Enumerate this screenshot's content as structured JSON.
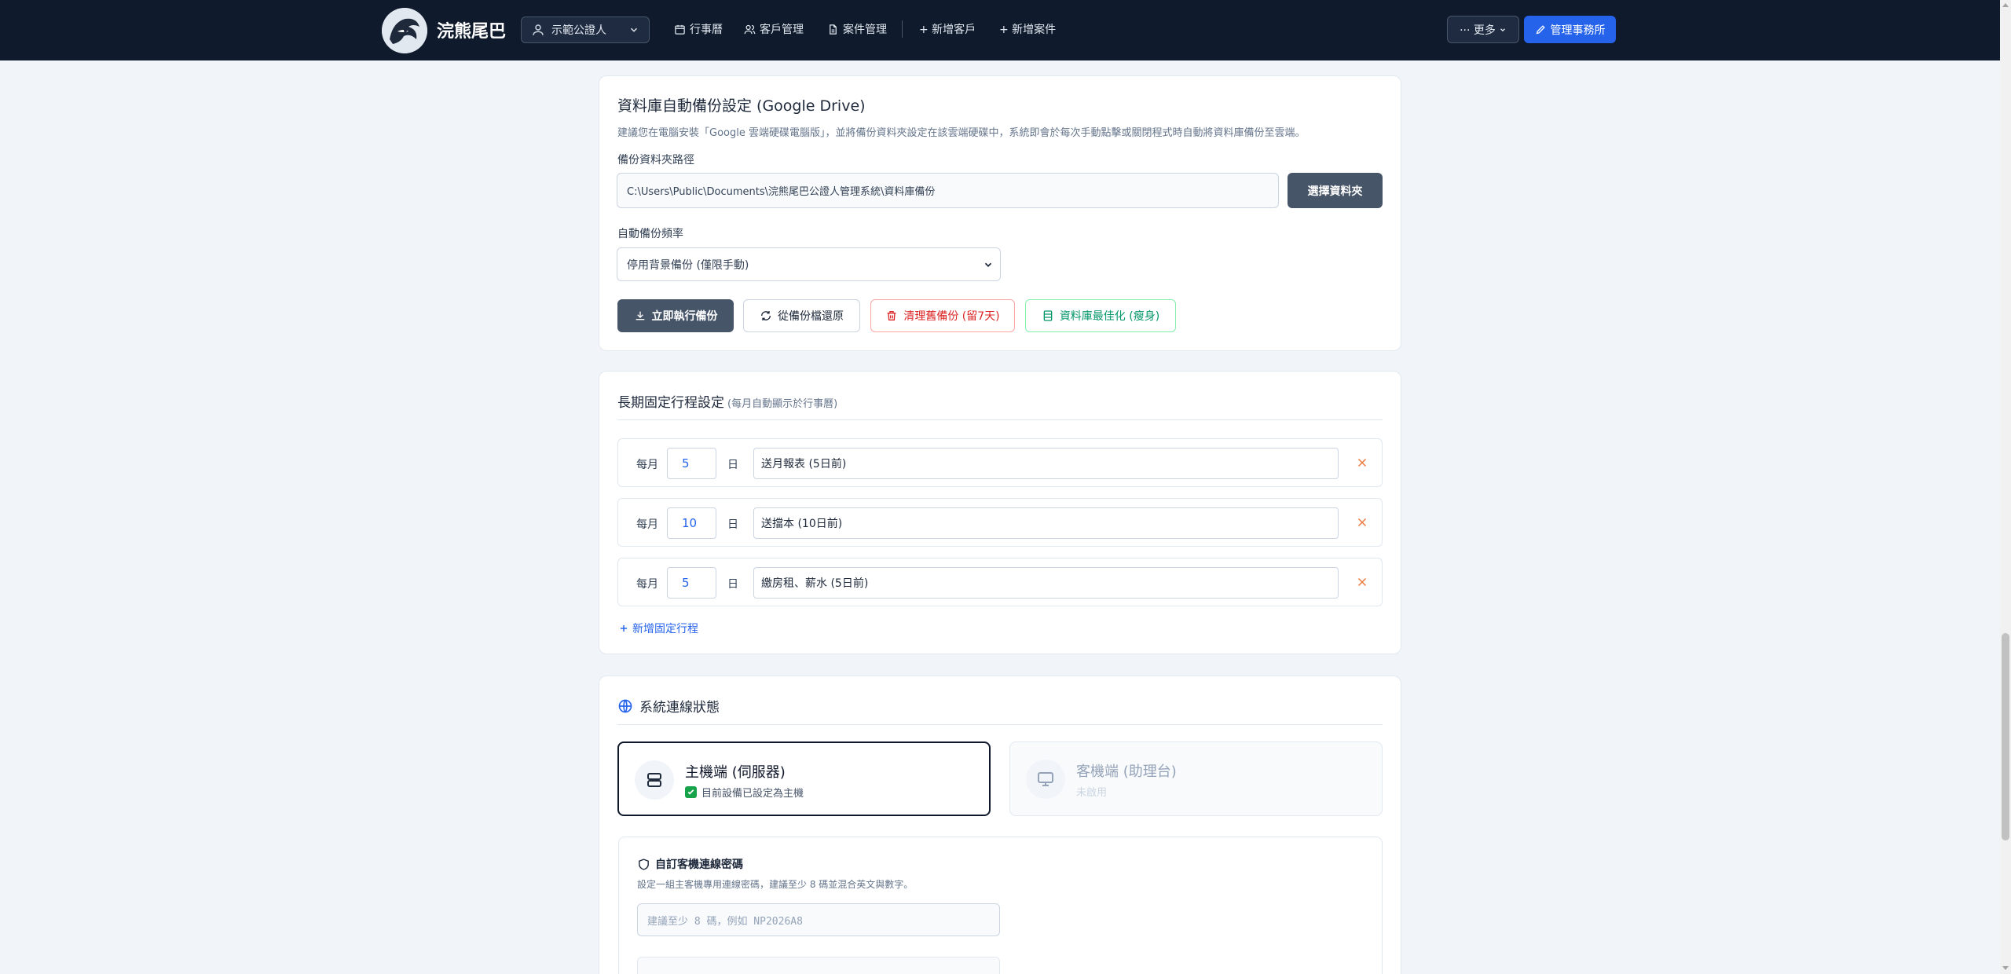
{
  "header": {
    "brand": "浣熊尾巴",
    "role": "示範公證人",
    "nav": {
      "calendar": "行事曆",
      "clients": "客戶管理",
      "cases": "案件管理",
      "add_client": "+ 新增客戶",
      "add_case": "+ 新增案件"
    },
    "more": "··· 更多",
    "admin": "管理事務所"
  },
  "backup": {
    "title": "資料庫自動備份設定 (Google Drive)",
    "description": "建議您在電腦安裝「Google 雲端硬碟電腦版」，並將備份資料夾設定在該雲端硬碟中，系統即會於每次手動點擊或關閉程式時自動將資料庫備份至雲端。",
    "folder_label": "備份資料夾路徑",
    "folder_value": "C:\\Users\\Public\\Documents\\浣熊尾巴公證人管理系統\\資料庫備份",
    "choose_button": "選擇資料夾",
    "frequency_label": "自動備份頻率",
    "frequency_value": "停用背景備份 (僅限手動)",
    "buttons": {
      "backup_now": "立即執行備份",
      "restore": "從備份檔還原",
      "clean": "清理舊備份 (留7天)",
      "optimize": "資料庫最佳化 (瘦身)"
    }
  },
  "recurring": {
    "title": "長期固定行程設定",
    "subtitle": "(每月自動顯示於行事曆)",
    "prefix": "每月",
    "suffix": "日",
    "rows": [
      {
        "day": "5",
        "title": "送月報表 (5日前)"
      },
      {
        "day": "10",
        "title": "送擋本 (10日前)"
      },
      {
        "day": "5",
        "title": "繳房租、薪水 (5日前)"
      }
    ],
    "add_label": "新增固定行程"
  },
  "connection": {
    "title": "系統連線狀態",
    "host": {
      "title": "主機端 (伺服器)",
      "status": "目前設備已設定為主機"
    },
    "client": {
      "title": "客機端 (助理台)",
      "status": "未啟用"
    },
    "password": {
      "title": "自訂客機連線密碼",
      "description": "設定一組主客機專用連線密碼，建議至少 8 碼並混合英文與數字。",
      "placeholder": "建議至少 8 碼，例如 NP2026A8"
    }
  },
  "colors": {
    "nav_bg": "#0f1b2d",
    "primary": "#2563eb",
    "danger": "#dc2626",
    "success": "#059669"
  }
}
